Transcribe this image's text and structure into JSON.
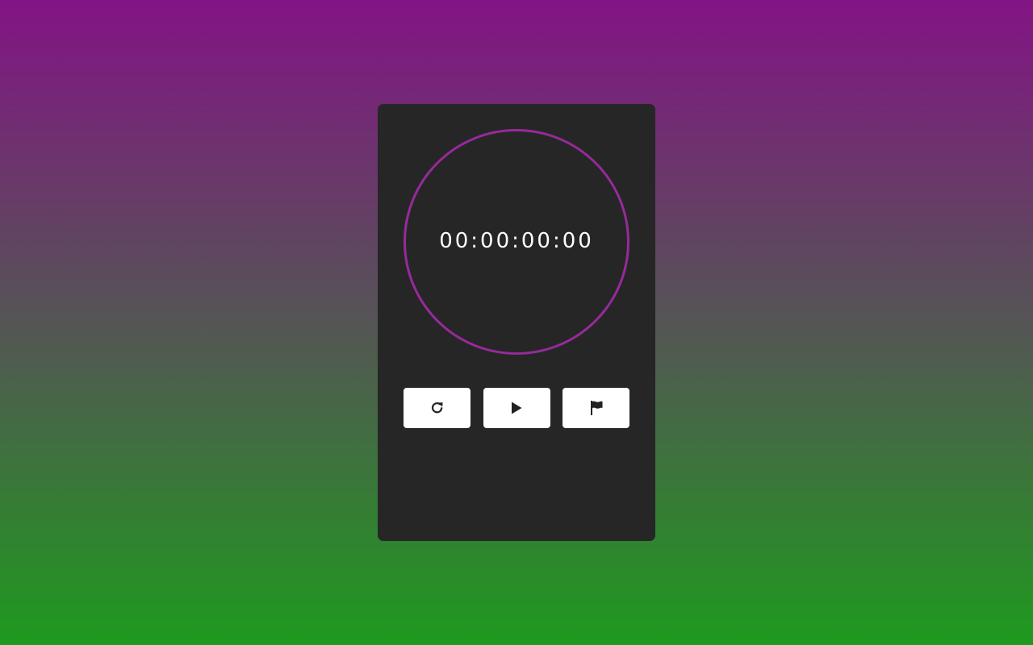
{
  "stopwatch": {
    "time_display": "00:00:00:00",
    "ring_color": "#962a9b",
    "card_color": "#262626"
  },
  "background": {
    "gradient_top": "#831485",
    "gradient_middle": "#555555",
    "gradient_bottom": "#1e9a1e"
  },
  "controls": [
    {
      "name": "reset",
      "icon": "redo-icon"
    },
    {
      "name": "start",
      "icon": "play-icon"
    },
    {
      "name": "lap",
      "icon": "flag-icon"
    }
  ]
}
